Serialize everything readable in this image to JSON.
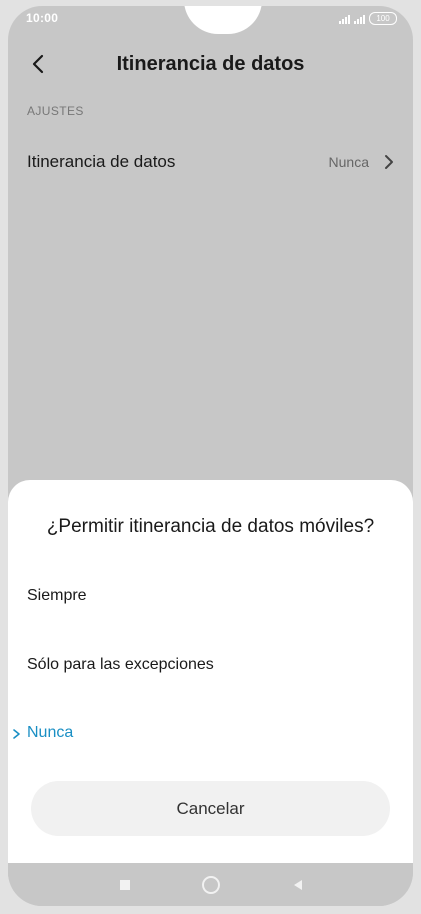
{
  "status_bar": {
    "time": "10:00",
    "battery": "100"
  },
  "header": {
    "title": "Itinerancia de datos"
  },
  "section": {
    "label": "AJUSTES"
  },
  "setting_row": {
    "label": "Itinerancia de datos",
    "value": "Nunca"
  },
  "dialog": {
    "title": "¿Permitir itinerancia de datos móviles?",
    "options": [
      {
        "label": "Siempre",
        "selected": false
      },
      {
        "label": "Sólo para las excepciones",
        "selected": false
      },
      {
        "label": "Nunca",
        "selected": true
      }
    ],
    "cancel_label": "Cancelar"
  },
  "colors": {
    "accent": "#1a8fc4",
    "overlay_background": "#c7c7c7",
    "sheet_background": "#ffffff"
  },
  "icons": {
    "back": "back-arrow-icon",
    "chevron": "chevron-right-icon",
    "selected_marker": "chevron-right-icon",
    "nav_recent": "square-icon",
    "nav_home": "circle-icon",
    "nav_back": "triangle-back-icon"
  }
}
